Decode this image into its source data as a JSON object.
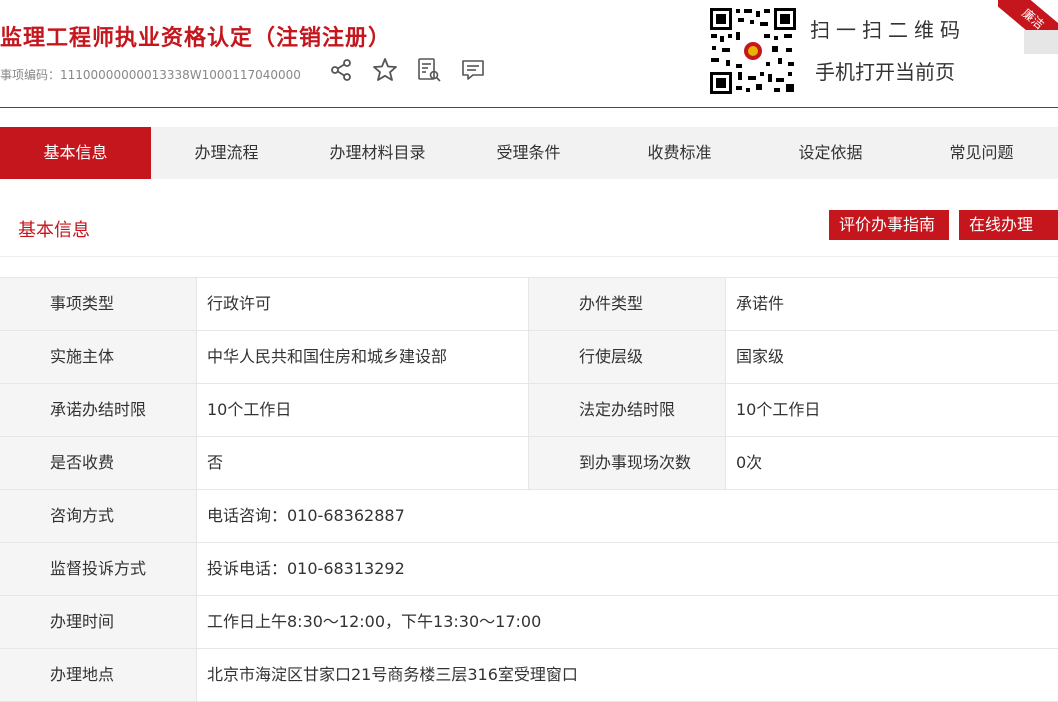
{
  "header": {
    "title": "监理工程师执业资格认定（注销注册）",
    "item_code": "事项编码：11100000000013338W1000117040000",
    "qr_line1": "扫一扫二维码",
    "qr_line2": "手机打开当前页",
    "corner_badge": "廉洁"
  },
  "tabs": [
    {
      "label": "基本信息",
      "active": true
    },
    {
      "label": "办理流程"
    },
    {
      "label": "办理材料目录"
    },
    {
      "label": "受理条件"
    },
    {
      "label": "收费标准"
    },
    {
      "label": "设定依据"
    },
    {
      "label": "常见问题"
    }
  ],
  "section": {
    "title": "基本信息",
    "evaluate_button": "评价办事指南",
    "online_button": "在线办理"
  },
  "table": {
    "rows": [
      {
        "l1": "事项类型",
        "v1": "行政许可",
        "l2": "办件类型",
        "v2": "承诺件"
      },
      {
        "l1": "实施主体",
        "v1": "中华人民共和国住房和城乡建设部",
        "l2": "行使层级",
        "v2": "国家级"
      },
      {
        "l1": "承诺办结时限",
        "v1": "10个工作日",
        "l2": "法定办结时限",
        "v2": "10个工作日"
      },
      {
        "l1": "是否收费",
        "v1": "否",
        "l2": "到办事现场次数",
        "v2": "0次"
      },
      {
        "l1": "咨询方式",
        "v1": "电话咨询：010-68362887"
      },
      {
        "l1": "监督投诉方式",
        "v1": "投诉电话：010-68313292"
      },
      {
        "l1": "办理时间",
        "v1": "工作日上午8:30～12:00，下午13:30～17:00"
      },
      {
        "l1": "办理地点",
        "v1": "北京市海淀区甘家口21号商务楼三层316室受理窗口"
      }
    ]
  },
  "icons": [
    "share-icon",
    "star-icon",
    "search-document-icon",
    "comment-icon"
  ],
  "colors": {
    "accent": "#c4161c",
    "tab_bg": "#f2f2f2",
    "label_bg": "#f5f5f5"
  }
}
